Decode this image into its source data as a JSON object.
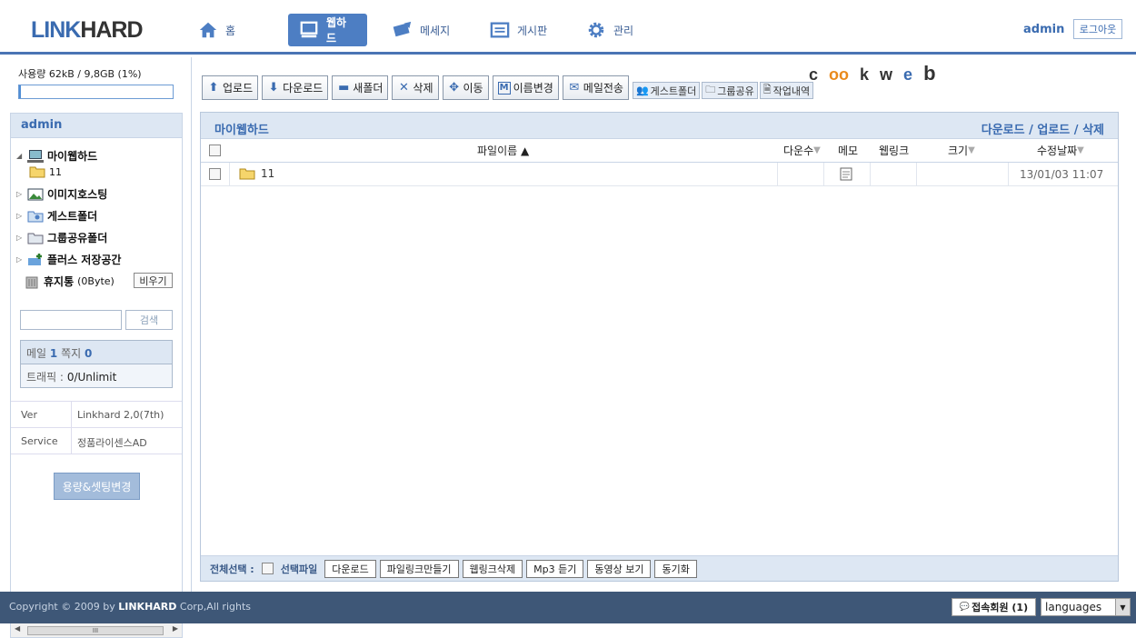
{
  "header": {
    "logo_link": "LINK",
    "logo_hard": "HARD",
    "nav": [
      {
        "label": "홈"
      },
      {
        "label": "웹하드"
      },
      {
        "label": "메세지"
      },
      {
        "label": "게시판"
      },
      {
        "label": "관리"
      }
    ],
    "user": "admin",
    "logout": "로그아웃"
  },
  "sidebar": {
    "usage_text": "사용량 62kB / 9,8GB (1%)",
    "usage_percent": 1,
    "tree_title": "admin",
    "tree": {
      "my_webhard": "마이웹하드",
      "sub_folder": "11",
      "image_hosting": "이미지호스팅",
      "guest_folder": "게스트폴더",
      "group_folder": "그룹공유폴더",
      "plus_storage": "플러스 저장공간",
      "trash": "휴지통",
      "trash_size": "(0Byte)",
      "empty_btn": "비우기"
    },
    "search_btn": "검색",
    "info": {
      "mail_label": "메일",
      "mail_count": "1",
      "note_label": "쪽지",
      "note_count": "0",
      "traffic_label": "트래픽 :",
      "traffic_value": "0/Unlimit"
    },
    "version": [
      {
        "key": "Ver",
        "value": "Linkhard 2,0(7th)"
      },
      {
        "key": "Service",
        "value": "정품라이센스AD"
      }
    ],
    "change_btn": "용량&셋팅변경",
    "scroll_thumb": "III"
  },
  "toolbar": {
    "upload": "업로드",
    "download": "다운로드",
    "new_folder": "새폴더",
    "delete": "삭제",
    "move": "이동",
    "rename": "이름변경",
    "mail": "메일전송",
    "guest": "게스트폴더",
    "group": "그룹공유",
    "history": "작업내역"
  },
  "cookweb": {
    "c": "c",
    "oo": "oo",
    "k": "k",
    "w": "w",
    "e": "e",
    "b": "b"
  },
  "panel": {
    "title": "마이웹하드",
    "right_links": "다운로드 / 업로드 / 삭제",
    "columns": {
      "name": "파일이름 ▲",
      "downloads": "다운수",
      "memo": "메모",
      "weblink": "웹링크",
      "size": "크기",
      "modified": "수정날짜"
    },
    "rows": [
      {
        "name": "11",
        "modified": "13/01/03 11:07"
      }
    ],
    "footer": {
      "select_all": "전체선택 :",
      "selected_files": "선택파일",
      "buttons": [
        "다운로드",
        "파일링크만들기",
        "웹링크삭제",
        "Mp3 듣기",
        "동영상 보기",
        "동기화"
      ]
    }
  },
  "footer": {
    "copyright_pre": "Copyright © 2009 by ",
    "copyright_brand": "LINKHARD",
    "copyright_post": " Corp,All rights",
    "online": "접속회원 (1)",
    "languages": "languages"
  }
}
